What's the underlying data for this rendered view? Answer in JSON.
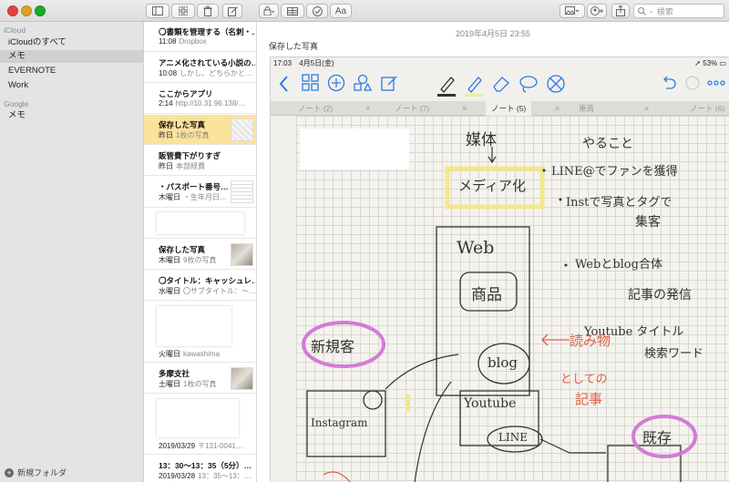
{
  "toolbar": {
    "view_labels": {
      "font": "Aa"
    },
    "search_placeholder": "検索"
  },
  "sidebar": {
    "sections": [
      {
        "label": "iCloud",
        "items": [
          {
            "label": "iCloudのすべて"
          },
          {
            "label": "メモ",
            "selected": true
          },
          {
            "label": "EVERNOTE"
          },
          {
            "label": "Work"
          }
        ]
      },
      {
        "label": "Google",
        "items": [
          {
            "label": "メモ"
          }
        ]
      }
    ],
    "new_folder_label": "新規フォルダ"
  },
  "note_list": [
    {
      "title": "〇書類を管理する（名刺・…",
      "date": "11:08",
      "preview": "Dropbox"
    },
    {
      "title": "アニメ化されている小説の…",
      "date": "10:08",
      "preview": "しかし、どちらかと…"
    },
    {
      "title": "ここからアプリ",
      "date": "2:14",
      "preview": "http://10.31.96.138/…"
    },
    {
      "title": "保存した写真",
      "date": "昨日",
      "preview": "1枚の写真",
      "selected": true
    },
    {
      "title": "販管費下がりすぎ",
      "date": "昨日",
      "preview": "本部経費"
    },
    {
      "title": "・パスポート番号…",
      "date": "木曜日",
      "preview": "・生年月日…"
    },
    {
      "title": "",
      "date": "",
      "preview": ""
    },
    {
      "title": "保存した写真",
      "date": "木曜日",
      "preview": "9枚の写真"
    },
    {
      "title": "〇タイトル：キャッシュレ…",
      "date": "水曜日",
      "preview": "〇サブタイトル：～…"
    },
    {
      "title": "",
      "date": "火曜日",
      "preview": "kawashima"
    },
    {
      "title": "多摩支社",
      "date": "土曜日",
      "preview": "1枚の写真"
    },
    {
      "title": "",
      "date": "2019/03/29",
      "preview": "〒131-0041…"
    },
    {
      "title": "13：30～13：35（5分）…",
      "date": "2019/03/28",
      "preview": "13：35～13：…"
    }
  ],
  "main": {
    "date": "2019年4月5日 23:55",
    "heading": "保存した写真"
  },
  "ipad": {
    "time": "17:03",
    "date": "4月5日(金)",
    "battery": "53%",
    "tabs": [
      "ノート (2)",
      "ノート (7)",
      "ノート (5)",
      "東商",
      "ノート (6)"
    ],
    "handwriting": {
      "media": "媒体",
      "media_sub": "メディア化",
      "todo": "やること",
      "todo1": "LINE@でファンを獲得",
      "todo2": "Instで写真とタグで",
      "todo2b": "集客",
      "todo3": "Webとblog合体",
      "todo3b": "記事の発信",
      "todo4": "Youtube タイトル",
      "todo4b": "検索ワード",
      "web": "Web",
      "product": "商品",
      "blog": "blog",
      "reading": "読み物",
      "as_article": "としての",
      "article": "記事",
      "youtube": "Youtube",
      "line": "LINE",
      "new_customer": "新規客",
      "existing": "既存",
      "instagram": "Instagram"
    }
  },
  "colors": {
    "selected_note": "#fbe39b",
    "highlight_yellow": "#f3e88a",
    "circle_pink": "#d27bd6",
    "red_ink": "#e0604a"
  }
}
